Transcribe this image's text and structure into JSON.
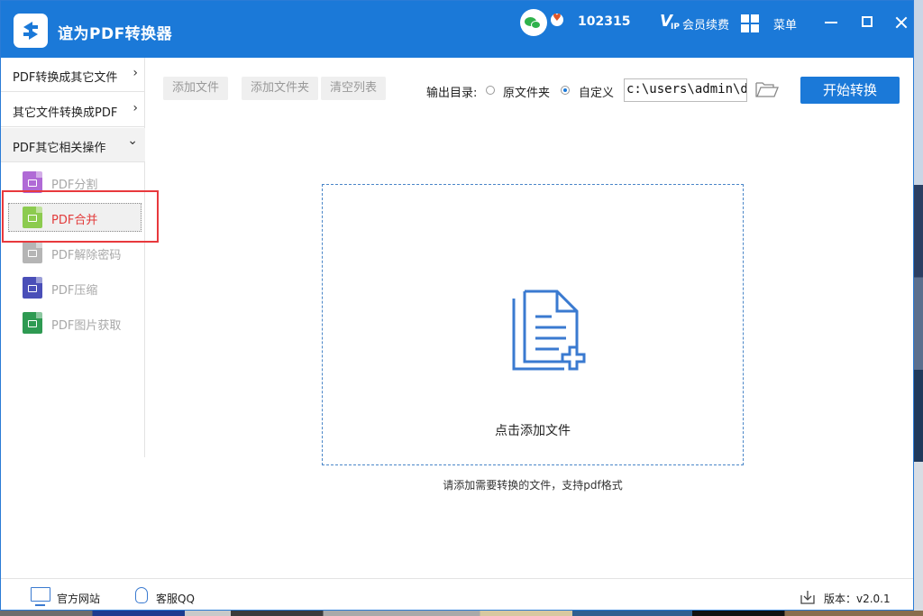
{
  "app": {
    "title": "谊为PDF转换器"
  },
  "header": {
    "user_id": "102315",
    "vip_label": "会员续费",
    "vip_icon_text": "V",
    "vip_icon_sub": "IP",
    "menu_label": "菜单"
  },
  "sidebar": {
    "categories": [
      {
        "label": "PDF转换成其它文件",
        "chevron": "›"
      },
      {
        "label": "其它文件转换成PDF",
        "chevron": "›"
      },
      {
        "label": "PDF其它相关操作",
        "chevron": "⌄"
      }
    ],
    "items": [
      {
        "label": "PDF分割",
        "color": "#b06ad6"
      },
      {
        "label": "PDF合并",
        "color": "#8ccb4f",
        "active": true
      },
      {
        "label": "PDF解除密码",
        "color": "#b5b5b5"
      },
      {
        "label": "PDF压缩",
        "color": "#4a4fb8"
      },
      {
        "label": "PDF图片获取",
        "color": "#2e9a52"
      }
    ]
  },
  "toolbar": {
    "add_file": "添加文件",
    "add_folder": "添加文件夹",
    "clear_list": "清空列表",
    "output_label": "输出目录:",
    "option_original": "原文件夹",
    "option_custom": "自定义",
    "output_path": "c:\\users\\admin\\d",
    "start_button": "开始转换"
  },
  "dropzone": {
    "text": "点击添加文件",
    "hint": "请添加需要转换的文件，支持pdf格式"
  },
  "footer": {
    "website": "官方网站",
    "qq": "客服QQ",
    "version": "版本：v2.0.1"
  },
  "colors": {
    "accent": "#1b79d8",
    "active_text": "#e23c3c",
    "highlight_border": "#e8393d"
  }
}
